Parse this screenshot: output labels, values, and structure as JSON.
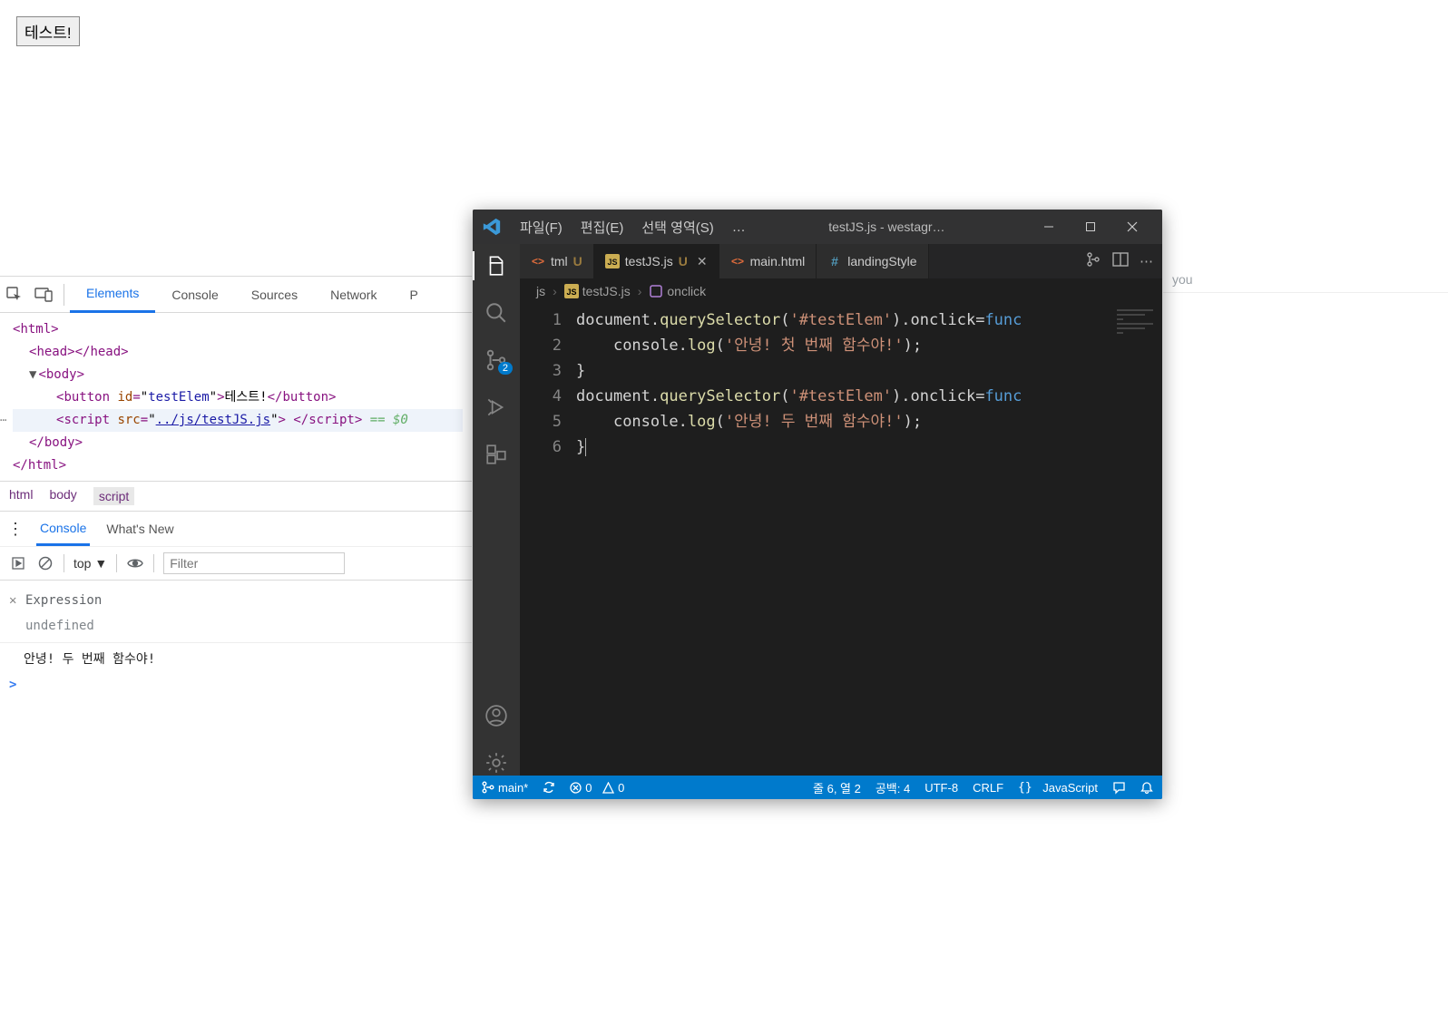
{
  "page": {
    "button_label": "테스트!"
  },
  "devtools": {
    "tabs": [
      "Elements",
      "Console",
      "Sources",
      "Network"
    ],
    "more_label": "P",
    "tree": {
      "html_open": "html",
      "head": "head",
      "body_open": "body",
      "button_tag": "button",
      "button_id_attr": "id",
      "button_id_val": "testElem",
      "button_text": "테스트!",
      "script_tag": "script",
      "script_src_attr": "src",
      "script_src_val": "../js/testJS.js",
      "selected_marker": "== $0"
    },
    "breadcrumbs": [
      "html",
      "body",
      "script"
    ],
    "drawer_tabs": [
      "Console",
      "What's New"
    ],
    "context_label": "top",
    "filter_placeholder": "Filter",
    "expression_label": "Expression",
    "undefined_label": "undefined",
    "log_output": "안녕! 두 번째 함수야!",
    "prompt": ">"
  },
  "vscode": {
    "menus": [
      "파일(F)",
      "편집(E)",
      "선택 영역(S)"
    ],
    "menu_overflow": "…",
    "title": "testJS.js - westagr…",
    "tabs": [
      {
        "icon": "html",
        "label": "tml",
        "modified": "U",
        "active": false
      },
      {
        "icon": "js",
        "label": "testJS.js",
        "modified": "U",
        "active": true
      },
      {
        "icon": "html",
        "label": "main.html",
        "modified": "",
        "active": false
      },
      {
        "icon": "css",
        "label": "landingStyle",
        "modified": "",
        "active": false
      }
    ],
    "breadcrumb": {
      "folder": "js",
      "file": "testJS.js",
      "symbol": "onclick"
    },
    "code_lines": [
      {
        "n": 1,
        "tokens": [
          [
            "ident",
            "document"
          ],
          [
            "punc",
            "."
          ],
          [
            "method",
            "querySelector"
          ],
          [
            "punc",
            "("
          ],
          [
            "str",
            "'#testElem'"
          ],
          [
            "punc",
            ")."
          ],
          [
            "ident",
            "onclick"
          ],
          [
            "punc",
            "="
          ],
          [
            "kw",
            "func"
          ]
        ]
      },
      {
        "n": 2,
        "indent": 1,
        "tokens": [
          [
            "ident",
            "console"
          ],
          [
            "punc",
            "."
          ],
          [
            "method",
            "log"
          ],
          [
            "punc",
            "("
          ],
          [
            "str",
            "'안녕! 첫 번째 함수야!'"
          ],
          [
            "punc",
            ");"
          ]
        ]
      },
      {
        "n": 3,
        "tokens": [
          [
            "punc",
            "}"
          ]
        ]
      },
      {
        "n": 4,
        "tokens": [
          [
            "ident",
            "document"
          ],
          [
            "punc",
            "."
          ],
          [
            "method",
            "querySelector"
          ],
          [
            "punc",
            "("
          ],
          [
            "str",
            "'#testElem'"
          ],
          [
            "punc",
            ")."
          ],
          [
            "ident",
            "onclick"
          ],
          [
            "punc",
            "="
          ],
          [
            "kw",
            "func"
          ]
        ]
      },
      {
        "n": 5,
        "indent": 1,
        "tokens": [
          [
            "ident",
            "console"
          ],
          [
            "punc",
            "."
          ],
          [
            "method",
            "log"
          ],
          [
            "punc",
            "("
          ],
          [
            "str",
            "'안녕! 두 번째 함수야!'"
          ],
          [
            "punc",
            ");"
          ]
        ]
      },
      {
        "n": 6,
        "tokens": [
          [
            "punc",
            "}"
          ]
        ]
      }
    ],
    "activity_badge": "2",
    "status": {
      "branch": "main*",
      "errors": "0",
      "warnings": "0",
      "position": "줄 6, 열 2",
      "spaces": "공백: 4",
      "encoding": "UTF-8",
      "eol": "CRLF",
      "lang": "JavaScript"
    }
  },
  "bg_hint": "you"
}
